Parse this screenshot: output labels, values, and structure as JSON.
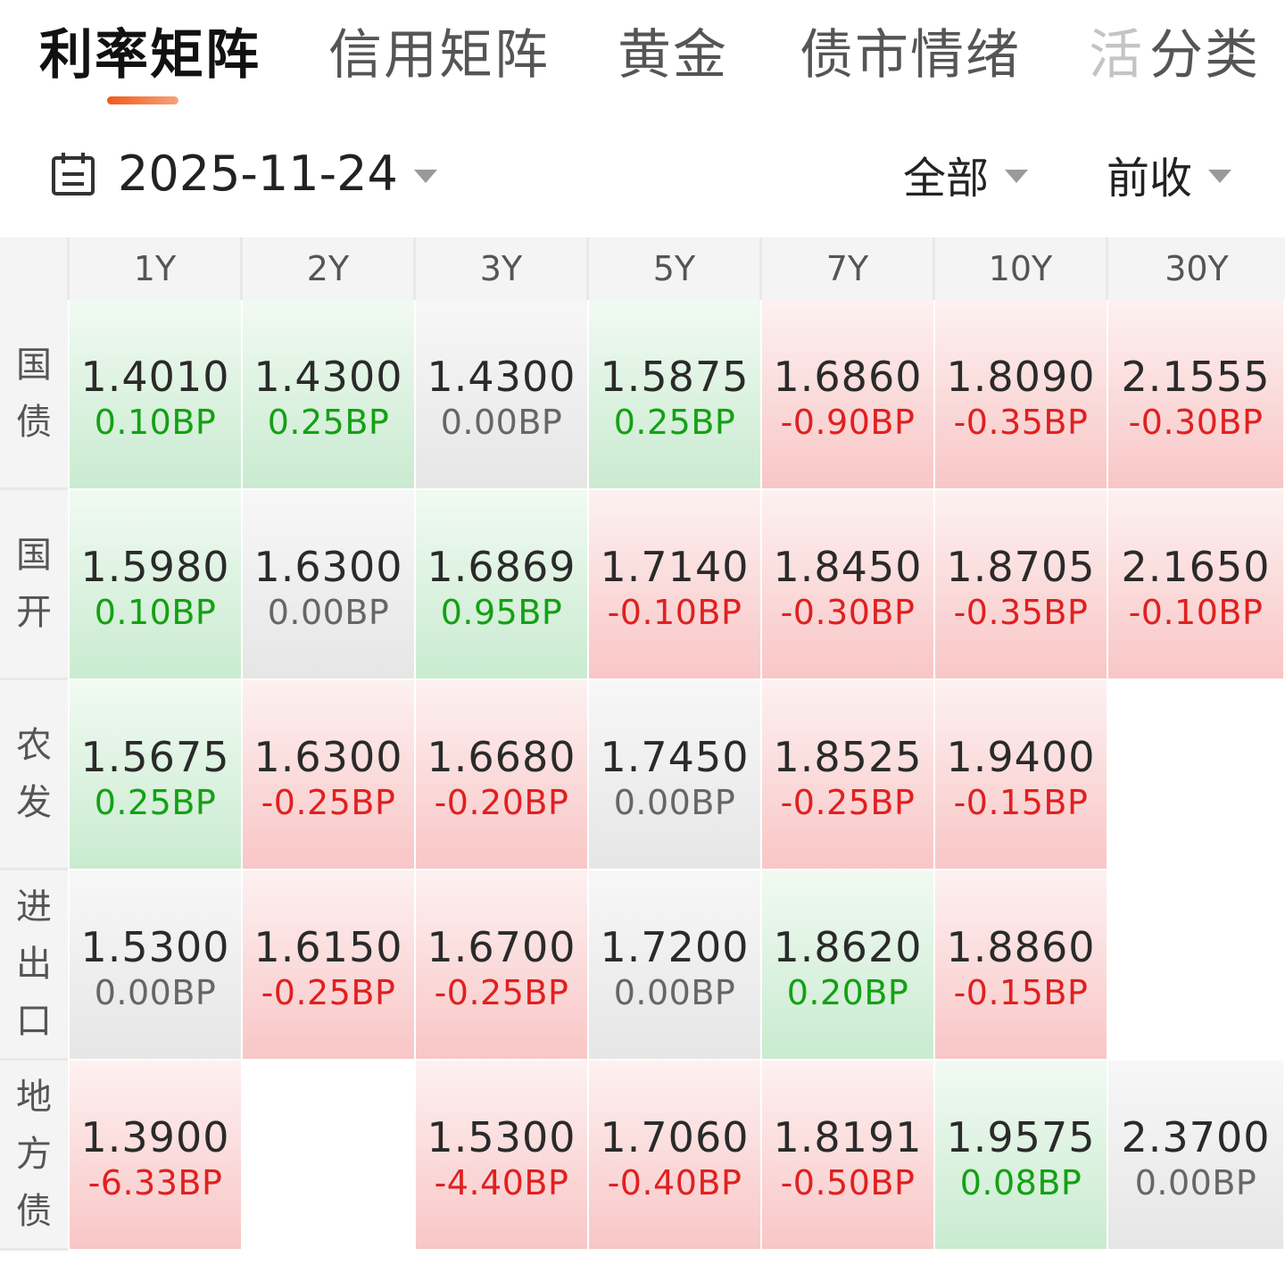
{
  "tabs": [
    {
      "label": "利率矩阵",
      "active": true
    },
    {
      "label": "信用矩阵",
      "active": false
    },
    {
      "label": "黄金",
      "active": false
    },
    {
      "label": "债市情绪",
      "active": false
    },
    {
      "label": "活",
      "active": false
    },
    {
      "label": "分类",
      "active": false
    }
  ],
  "filters": {
    "date": "2025-11-24",
    "category": "全部",
    "compare": "前收"
  },
  "icons": {
    "date": "calendar-icon",
    "dropdown": "chevron-down-icon"
  },
  "colors": {
    "accent": "#f05a1a",
    "rise": "#e02020",
    "fall": "#14a014",
    "neutral": "#666666",
    "rise_bg": "#f9c6c6",
    "fall_bg": "#c9ebd0",
    "flat_bg": "#e6e6e6"
  },
  "matrix": {
    "columns": [
      "1Y",
      "2Y",
      "3Y",
      "5Y",
      "7Y",
      "10Y",
      "30Y"
    ],
    "rows": [
      {
        "label": "国债",
        "cells": [
          {
            "rate": "1.4010",
            "change": "0.10BP",
            "trend": "down"
          },
          {
            "rate": "1.4300",
            "change": "0.25BP",
            "trend": "down"
          },
          {
            "rate": "1.4300",
            "change": "0.00BP",
            "trend": "flat"
          },
          {
            "rate": "1.5875",
            "change": "0.25BP",
            "trend": "down"
          },
          {
            "rate": "1.6860",
            "change": "-0.90BP",
            "trend": "up"
          },
          {
            "rate": "1.8090",
            "change": "-0.35BP",
            "trend": "up"
          },
          {
            "rate": "2.1555",
            "change": "-0.30BP",
            "trend": "up"
          }
        ]
      },
      {
        "label": "国开",
        "cells": [
          {
            "rate": "1.5980",
            "change": "0.10BP",
            "trend": "down"
          },
          {
            "rate": "1.6300",
            "change": "0.00BP",
            "trend": "flat"
          },
          {
            "rate": "1.6869",
            "change": "0.95BP",
            "trend": "down"
          },
          {
            "rate": "1.7140",
            "change": "-0.10BP",
            "trend": "up"
          },
          {
            "rate": "1.8450",
            "change": "-0.30BP",
            "trend": "up"
          },
          {
            "rate": "1.8705",
            "change": "-0.35BP",
            "trend": "up"
          },
          {
            "rate": "2.1650",
            "change": "-0.10BP",
            "trend": "up"
          }
        ]
      },
      {
        "label": "农发",
        "cells": [
          {
            "rate": "1.5675",
            "change": "0.25BP",
            "trend": "down"
          },
          {
            "rate": "1.6300",
            "change": "-0.25BP",
            "trend": "up"
          },
          {
            "rate": "1.6680",
            "change": "-0.20BP",
            "trend": "up"
          },
          {
            "rate": "1.7450",
            "change": "0.00BP",
            "trend": "flat"
          },
          {
            "rate": "1.8525",
            "change": "-0.25BP",
            "trend": "up"
          },
          {
            "rate": "1.9400",
            "change": "-0.15BP",
            "trend": "up"
          },
          null
        ]
      },
      {
        "label": "进出口",
        "cells": [
          {
            "rate": "1.5300",
            "change": "0.00BP",
            "trend": "flat"
          },
          {
            "rate": "1.6150",
            "change": "-0.25BP",
            "trend": "up"
          },
          {
            "rate": "1.6700",
            "change": "-0.25BP",
            "trend": "up"
          },
          {
            "rate": "1.7200",
            "change": "0.00BP",
            "trend": "flat"
          },
          {
            "rate": "1.8620",
            "change": "0.20BP",
            "trend": "down"
          },
          {
            "rate": "1.8860",
            "change": "-0.15BP",
            "trend": "up"
          },
          null
        ]
      },
      {
        "label": "地方债",
        "cells": [
          {
            "rate": "1.3900",
            "change": "-6.33BP",
            "trend": "up"
          },
          null,
          {
            "rate": "1.5300",
            "change": "-4.40BP",
            "trend": "up"
          },
          {
            "rate": "1.7060",
            "change": "-0.40BP",
            "trend": "up"
          },
          {
            "rate": "1.8191",
            "change": "-0.50BP",
            "trend": "up"
          },
          {
            "rate": "1.9575",
            "change": "0.08BP",
            "trend": "down"
          },
          {
            "rate": "2.3700",
            "change": "0.00BP",
            "trend": "flat"
          }
        ]
      }
    ]
  }
}
